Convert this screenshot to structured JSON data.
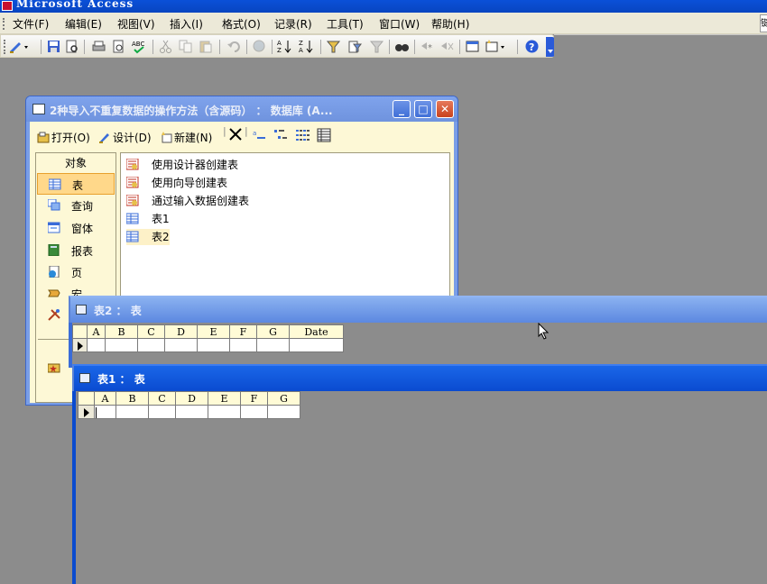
{
  "app": {
    "title": "Microsoft Access"
  },
  "menu": {
    "items": [
      "文件(F)",
      "编辑(E)",
      "视图(V)",
      "插入(I)",
      "格式(O)",
      "记录(R)",
      "工具(T)",
      "窗口(W)",
      "帮助(H)"
    ],
    "right_text": "键"
  },
  "toolbar": {
    "buttons": [
      "design-view",
      "save",
      "file-search",
      "print",
      "print-preview",
      "spelling",
      "cut",
      "copy",
      "paste",
      "undo",
      "insert-hyperlink",
      "sort-ascending",
      "sort-descending",
      "filter-by-selection",
      "filter-by-form",
      "apply-filter",
      "find",
      "new-record",
      "delete-record",
      "database-window",
      "new-object",
      "help"
    ]
  },
  "db_window": {
    "title": "2种导入不重复数据的操作方法（含源码） ： 数据库 (A...",
    "buttons": {
      "open": "打开(O)",
      "design": "设计(D)",
      "new": "新建(N)"
    },
    "objects_header": "对象",
    "objects": [
      "表",
      "查询",
      "窗体",
      "报表",
      "页",
      "宏",
      ""
    ],
    "selected_object": "表",
    "list_items": [
      {
        "label": "使用设计器创建表",
        "icon": "wizard-icon"
      },
      {
        "label": "使用向导创建表",
        "icon": "wizard-icon"
      },
      {
        "label": "通过输入数据创建表",
        "icon": "wizard-icon"
      },
      {
        "label": "表1",
        "icon": "table-icon"
      },
      {
        "label": "表2",
        "icon": "table-icon"
      }
    ]
  },
  "table2_window": {
    "title": "表2 ： 表",
    "columns": [
      "A",
      "B",
      "C",
      "D",
      "E",
      "F",
      "G",
      "Date"
    ]
  },
  "table1_window": {
    "title": "表1 ： 表",
    "columns": [
      "A",
      "B",
      "C",
      "D",
      "E",
      "F",
      "G"
    ]
  },
  "colors": {
    "desktop": "#8c8c8c",
    "active_title": "#0a4bd0",
    "inactive_title": "#7fa3ec",
    "panel_bg": "#fdf8d6",
    "selected_object": "#ffd88a"
  }
}
